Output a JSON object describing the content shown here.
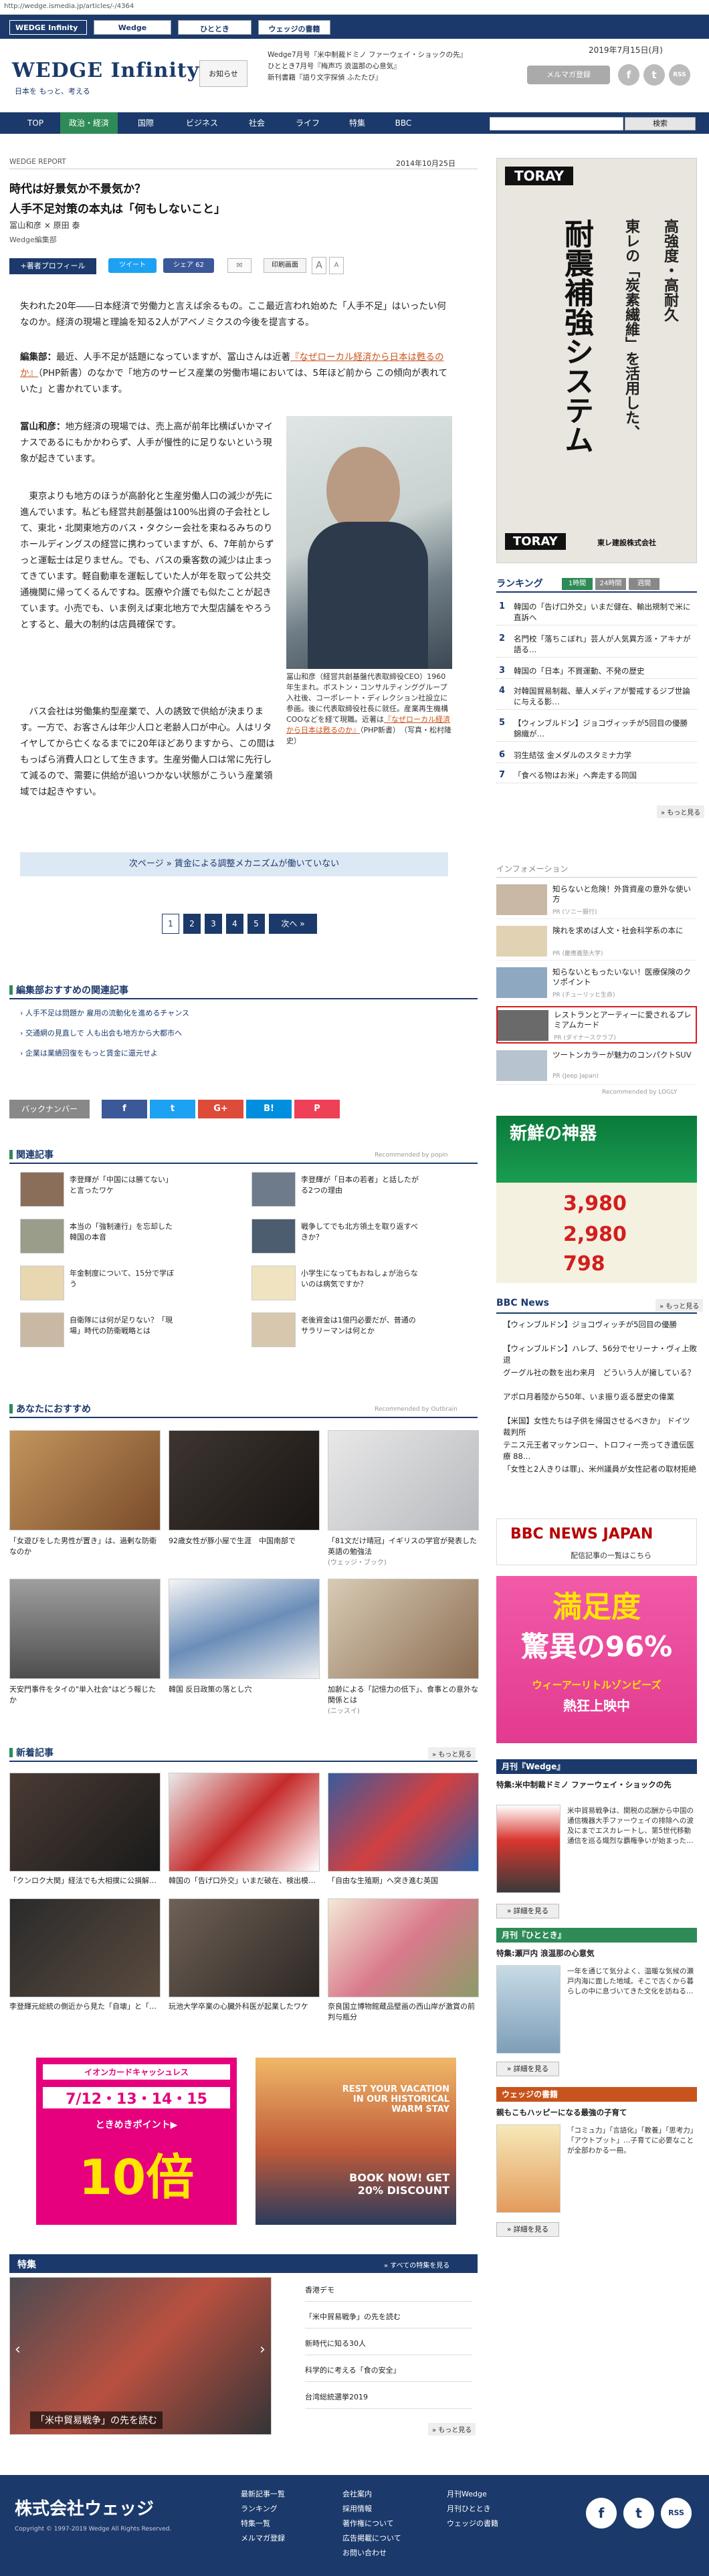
{
  "browser": {
    "url": "http://wedge.ismedia.jp/articles/-/4364"
  },
  "topstrip": {
    "tabs": [
      "WEDGE Infinity",
      "Wedge",
      "ひととき",
      "ウェッジの書籍"
    ]
  },
  "header": {
    "logo": "WEDGE Infinity",
    "tagline": "日本を もっと、考える",
    "notice_button": "お知らせ",
    "news": [
      "Wedge7月号『米中制裁ドミノ ファーウェイ・ショックの先』",
      "ひととき7月号『梅声巧 浪温那の心意気』",
      "新刊書籍『語り文字探偵 ふたたび』"
    ],
    "date": "2019年7月15日(月)",
    "mail_button": "メルマガ登録",
    "social": [
      "f",
      "t",
      "RSS"
    ]
  },
  "nav": {
    "items": [
      "TOP",
      "政治・経済",
      "国際",
      "ビジネス",
      "社会",
      "ライフ",
      "特集",
      "BBC"
    ],
    "search_placeholder": "",
    "search_button": "検索"
  },
  "article": {
    "category": "WEDGE REPORT",
    "date": "2014年10月25日",
    "title_line1": "時代は好景気か不景気か？",
    "title_line2": "人手不足対策の本丸は「何もしないこと」",
    "authors": "冨山和彦 × 原田 泰",
    "org": "Wedge編集部",
    "profile_button": "+著者プロフィール",
    "tweet": "ツイート",
    "share": "シェア 62",
    "print": "印刷画面",
    "font_a_large": "A",
    "font_a_small": "A",
    "intro": "失われた20年――日本経済で労働力と言えば余るもの。ここ最近言われ始めた「人手不足」はいったい何なのか。経済の現場と理論を知る2人がアベノミクスの今後を提言する。",
    "p1_label": "編集部：",
    "p1_text_a": "最近、人手不足が話題になっていますが、冨山さんは近著",
    "p1_link": "『なぜローカル経済から日本は甦るのか』",
    "p1_text_b": "（PHP新書）のなかで「地方のサービス産業の労働市場においては、5年ほど前から この傾向が表れていた」と書かれています。",
    "p2_label": "冨山和彦：",
    "p2_text": "地方経済の現場では、売上高が前年比横ばいかマイナスであるにもかかわらず、人手が慢性的に足りないという現象が起きています。",
    "p3": "東京よりも地方のほうが高齢化と生産労働人口の減少が先に進んでいます。私ども経営共創基盤は100%出資の子会社として、東北・北関東地方のバス・タクシー会社を束ねるみちのりホールディングスの経営に携わっていますが、6、7年前からずっと運転士は足りません。でも、バスの乗客数の減少は止まってきています。軽自動車を運転していた人が年を取って公共交通機関に帰ってくるんですね。医療や介護でも似たことが起きています。小売でも、いま例えば東北地方で大型店舗をやろうとすると、最大の制約は店員確保です。",
    "p4": "バス会社は労働集約型産業で、人の誘致で供給が決まります。一方で、お客さんは年少人口と老齢人口が中心。人はリタイヤしてから亡くなるまでに20年ほどありますから、この間はもっぱら消費人口として生きます。生産労働人口は常に先行して減るので、需要に供給が追いつかない状態がこういう産業領域では起きやすい。",
    "photo_caption_a": "冨山和彦（経営共創基盤代表取締役CEO）1960年生まれ。ボストン・コンサルティンググループ入社後、コーポレート・ディレクション社設立に参画。後に代表取締役社長に就任。産業再生機構COOなどを経て現職。近著は",
    "photo_caption_link": "『なぜローカル経済から日本は甦るのか』",
    "photo_caption_b": "（PHP新書）　（写真・松村隆史）",
    "next_bar": "次ページ » 賃金による調整メカニズムが働いていない",
    "pager": [
      "1",
      "2",
      "3",
      "4",
      "5",
      "次へ »"
    ]
  },
  "recommend": {
    "title": "編集部おすすめの関連記事",
    "items": [
      "› 人手不足は問題か 雇用の流動化を進めるチャンス",
      "› 交通網の見直しで 人も出会も地方から大都市へ",
      "› 企業は業績回復をもっと賃金に還元せよ"
    ]
  },
  "share_bar": {
    "backnumber": "バックナンバー",
    "buttons": [
      "f",
      "t",
      "G+",
      "B!",
      "P"
    ]
  },
  "related": {
    "title": "関連記事",
    "powered": "Recommended by popin",
    "items": [
      "李登輝が「中国には勝てない」と言ったワケ",
      "李登輝が「日本の若者」と話したがる2つの理由",
      "本当の「強制連行」を忘却した韓国の本音",
      "戦争してでも北方領土を取り返すべきか？",
      "年金制度について、15分で学ぼう",
      "小学生になってもおねしょが治らないのは病気ですか？",
      "自衛隊には何が足りない？「現場」時代の防衛戦略とは",
      "老後資金は1億円必要だが、普通のサラリーマンは何とか"
    ]
  },
  "osusume": {
    "title": "あなたにおすすめ",
    "powered": "Recommended by Outbrain",
    "items": [
      {
        "title": "「女遊びをした男性が置き」は、過剰な防衛なのか",
        "src": ""
      },
      {
        "title": "92歳女性が豚小屋で生涯　中国南部で",
        "src": ""
      },
      {
        "title": "「81文だけ晴冠」イギリスの学官が発表した英語の勉強法",
        "src": "(ウェッジ・ブック)"
      },
      {
        "title": "天安門事件をタイの\"単入社会\"はどう報じたか",
        "src": ""
      },
      {
        "title": "韓国 反日政策の落とし穴",
        "src": ""
      },
      {
        "title": "加齢による「記憶力の低下」、食事との意外な関係とは",
        "src": "(ニッスイ)"
      }
    ]
  },
  "newest": {
    "title": "新着記事",
    "more": "» もっと見る",
    "items": [
      "「クンロク大関」経法でも大相撲に公損解…",
      "韓国の「告げ口外交」いまだ破在、検出模…",
      "「自由な生殖期」へ突き進む英国",
      "李登輝元総統の側近から見た「自壊」と「…",
      "玩池大学卒業の心臓外科医が起業したワケ",
      "奈良国立博物館蔵品壁画の西山岸が激賞の前判与瓶分"
    ]
  },
  "ads": {
    "aeon_title": "イオンカードキャッシュレス",
    "aeon_dates": "7/12・13・14・15",
    "aeon_mid": "ときめきポイント▶",
    "aeon_big": "10倍",
    "travel_a": "REST YOUR VACATION IN OUR HISTORICAL WARM STAY",
    "travel_b": "BOOK NOW! GET 20% DISCOUNT"
  },
  "tokushu": {
    "title": "特集",
    "more": "» すべての特集を見る",
    "banner": "「米中貿易戦争」の先を読む",
    "items": [
      "香港デモ",
      "「米中貿易戦争」の先を読む",
      "新時代に知る30人",
      "科学的に考える「食の安全」",
      "台湾総統選挙2019"
    ],
    "more2": "» もっと見る"
  },
  "sidebar": {
    "ad_top": {
      "brand": "TORAY",
      "line1": "高強度・高耐久",
      "line2": "東レの「炭素繊維」を活用した、",
      "line3": "耐震補強システム",
      "sub": "東レ建設株式会社"
    },
    "ranking_title": "ランキング",
    "ranking_tabs": [
      "1時間",
      "24時間",
      "週間"
    ],
    "ranking": [
      "韓国の「告げ口外交」いまだ健在、輸出規制で米に直訴へ",
      "名門校「落ちこぼれ」芸人が人気異方派・アキナが語る…",
      "韓国の「日本」不買運動、不発の歴史",
      "対韓国貿易制裁、華人メディアが警戒するジブ世論に与える影…",
      "【ウィンブルドン】ジョコヴィッチが5回目の優勝　錦織が…",
      "羽生結弦 金メダルのスタミナ力学",
      "「食べる物はお米」へ奔走する同国",
      ""
    ],
    "ranking_more": "» もっと見る",
    "info_title": "インフォメーション",
    "info": [
      {
        "text": "知らないと危険！外貨資産の意外な使い方",
        "pr": "PR (ソニー銀行)"
      },
      {
        "text": "険れを求めば人文・社会科学系の本に",
        "pr": "PR (慶應義塾大学)"
      },
      {
        "text": "知らないともったいない！医療保険のクソポイント",
        "pr": "PR (チューリッヒ生命)"
      },
      {
        "text": "レストランとアーティーに愛されるプレミアムカード",
        "pr": "PR (ダイナースクラブ)"
      },
      {
        "text": "ツートンカラーが魅力のコンパクトSUV",
        "pr": "PR (Jeep Japan)"
      }
    ],
    "logly": "Recommended by LOGLY",
    "shinki_ad": {
      "title": "新鮮の神器",
      "p1": "3,980",
      "p2": "2,980",
      "p3": "798"
    },
    "bbc_title": "BBC News",
    "bbc_more": "» もっと見る",
    "bbc": [
      "【ウィンブルドン】ジョコヴィッチが5回目の優勝",
      "【ウィンブルドン】ハレプ、56分でセリーナ・ヴィ上敗退",
      "グーグル社の数を出わ来月　どういう人が擁している？",
      "アポロ月着陸から50年、いま振り返る歴史の偉業",
      "【米国】女性たちは子供を帰国させるべきか」 ドイツ裁判所",
      "テニス元王者マッケンロー、トロフィー売ってき遺伝医療 88…",
      "「女性と2人きりは罪」、米州議員が女性記者の取材拒絶"
    ],
    "bbc_logo": "BBC NEWS JAPAN",
    "bbc_sub": "配信記事の一覧はこちら",
    "manzoku": {
      "line1": "満足度",
      "line2": "驚異の96%",
      "line3": "ウィーアーリトルゾンビーズ",
      "line4": "熱狂上映中"
    },
    "wedge_mag_title": "月刊『Wedge』",
    "wedge_mag_head": "特集:米中制裁ドミノ ファーウェイ・ショックの先",
    "wedge_mag_text": "米中貿易戦争は、関税の応酬から中国の通信機器大手ファーウェイの排除への波及にまでエスカレートし、第5世代移動通信を巡る熾烈な覇権争いが始まった…",
    "detail": "» 詳細を見る",
    "hitotoki_title": "月刊『ひととき』",
    "hitotoki_head": "特集:瀬戸内 浪温那の心意気",
    "hitotoki_text": "一年を通じて気分よく、温暖な気候の瀬戸内海に面した地域。そこで古くから暮らしの中に息づいてきた文化を訪ねる…",
    "books_title": "ウェッジの書籍",
    "books_head": "親もこもハッピーになる最強の子育て",
    "books_text": "「コミュ力」「言語化」「教養」「思考力」「アウトプット」…子育てに必要なことが全部わかる一冊。"
  },
  "footer": {
    "logo": "株式会社ウェッジ",
    "copy": "Copyright © 1997-2019 Wedge All Rights Reserved.",
    "col1": [
      "最新記事一覧",
      "ランキング",
      "特集一覧",
      "メルマガ登録"
    ],
    "col2": [
      "会社案内",
      "採用情報",
      "著作権について",
      "広告掲載について",
      "お問い合わせ"
    ],
    "col3": [
      "月刊Wedge",
      "月刊ひととき",
      "ウェッジの書籍"
    ],
    "social": [
      "f",
      "t",
      "RSS"
    ]
  }
}
